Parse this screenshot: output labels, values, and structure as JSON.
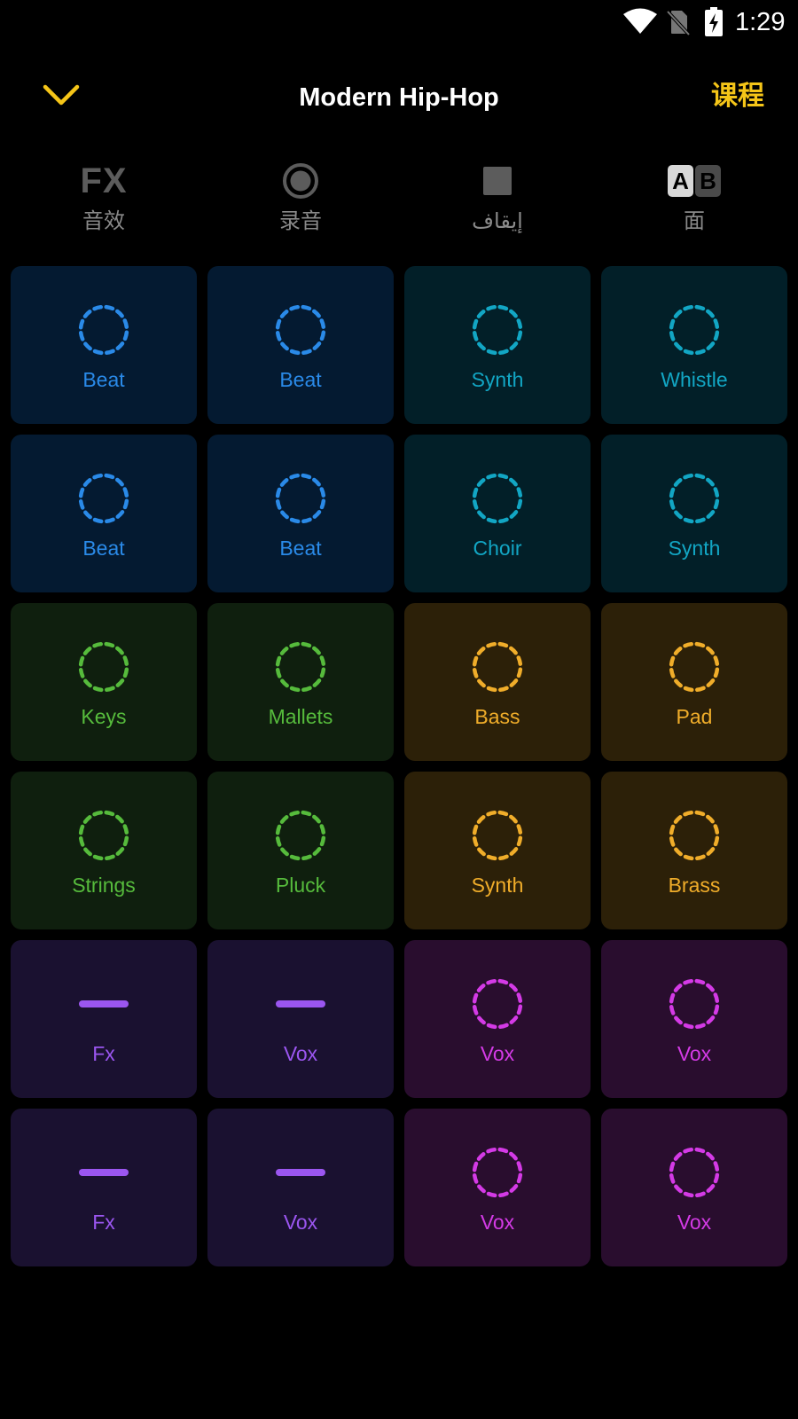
{
  "status_bar": {
    "time": "1:29",
    "icons": [
      "wifi-icon",
      "no-sim-icon",
      "battery-charging-icon"
    ]
  },
  "header": {
    "back_icon": "chevron-down-icon",
    "title": "Modern Hip-Hop",
    "course_label": "课程"
  },
  "toolbar": {
    "items": [
      {
        "icon": "fx-icon",
        "glyph": "FX",
        "label": "音效"
      },
      {
        "icon": "record-icon",
        "label": "录音"
      },
      {
        "icon": "stop-icon",
        "label": "إيقاف"
      },
      {
        "icon": "ab-switch-icon",
        "glyph_a": "A",
        "glyph_b": "B",
        "label": "面"
      }
    ]
  },
  "colors": {
    "blue": "#2a8ae8",
    "teal": "#12a6c4",
    "green": "#56bb3c",
    "gold": "#f0ad2a",
    "purple": "#9b56f0",
    "magenta": "#d43ae6",
    "accent": "#f5c518"
  },
  "pads": [
    {
      "label": "Beat",
      "color": "#2a8ae8",
      "bg": "#041a31",
      "icon": "dashed-circle-icon"
    },
    {
      "label": "Beat",
      "color": "#2a8ae8",
      "bg": "#041a31",
      "icon": "dashed-circle-icon"
    },
    {
      "label": "Synth",
      "color": "#12a6c4",
      "bg": "#021f28",
      "icon": "dashed-circle-icon"
    },
    {
      "label": "Whistle",
      "color": "#12a6c4",
      "bg": "#021f28",
      "icon": "dashed-circle-icon"
    },
    {
      "label": "Beat",
      "color": "#2a8ae8",
      "bg": "#041a31",
      "icon": "dashed-circle-icon"
    },
    {
      "label": "Beat",
      "color": "#2a8ae8",
      "bg": "#041a31",
      "icon": "dashed-circle-icon"
    },
    {
      "label": "Choir",
      "color": "#12a6c4",
      "bg": "#021f28",
      "icon": "dashed-circle-icon"
    },
    {
      "label": "Synth",
      "color": "#12a6c4",
      "bg": "#021f28",
      "icon": "dashed-circle-icon"
    },
    {
      "label": "Keys",
      "color": "#56bb3c",
      "bg": "#0f1f0e",
      "icon": "dashed-circle-icon"
    },
    {
      "label": "Mallets",
      "color": "#56bb3c",
      "bg": "#0f1f0e",
      "icon": "dashed-circle-icon"
    },
    {
      "label": "Bass",
      "color": "#f0ad2a",
      "bg": "#2c2008",
      "icon": "dashed-circle-icon"
    },
    {
      "label": "Pad",
      "color": "#f0ad2a",
      "bg": "#2c2008",
      "icon": "dashed-circle-icon"
    },
    {
      "label": "Strings",
      "color": "#56bb3c",
      "bg": "#0f1f0e",
      "icon": "dashed-circle-icon"
    },
    {
      "label": "Pluck",
      "color": "#56bb3c",
      "bg": "#0f1f0e",
      "icon": "dashed-circle-icon"
    },
    {
      "label": "Synth",
      "color": "#f0ad2a",
      "bg": "#2c2008",
      "icon": "dashed-circle-icon"
    },
    {
      "label": "Brass",
      "color": "#f0ad2a",
      "bg": "#2c2008",
      "icon": "dashed-circle-icon"
    },
    {
      "label": "Fx",
      "color": "#9b56f0",
      "bg": "#1a1130",
      "icon": "dash-line-icon"
    },
    {
      "label": "Vox",
      "color": "#9b56f0",
      "bg": "#1a1130",
      "icon": "dash-line-icon"
    },
    {
      "label": "Vox",
      "color": "#d43ae6",
      "bg": "#290d2e",
      "icon": "dashed-circle-icon"
    },
    {
      "label": "Vox",
      "color": "#d43ae6",
      "bg": "#290d2e",
      "icon": "dashed-circle-icon"
    },
    {
      "label": "Fx",
      "color": "#9b56f0",
      "bg": "#1a1130",
      "icon": "dash-line-icon"
    },
    {
      "label": "Vox",
      "color": "#9b56f0",
      "bg": "#1a1130",
      "icon": "dash-line-icon"
    },
    {
      "label": "Vox",
      "color": "#d43ae6",
      "bg": "#290d2e",
      "icon": "dashed-circle-icon"
    },
    {
      "label": "Vox",
      "color": "#d43ae6",
      "bg": "#290d2e",
      "icon": "dashed-circle-icon"
    }
  ]
}
